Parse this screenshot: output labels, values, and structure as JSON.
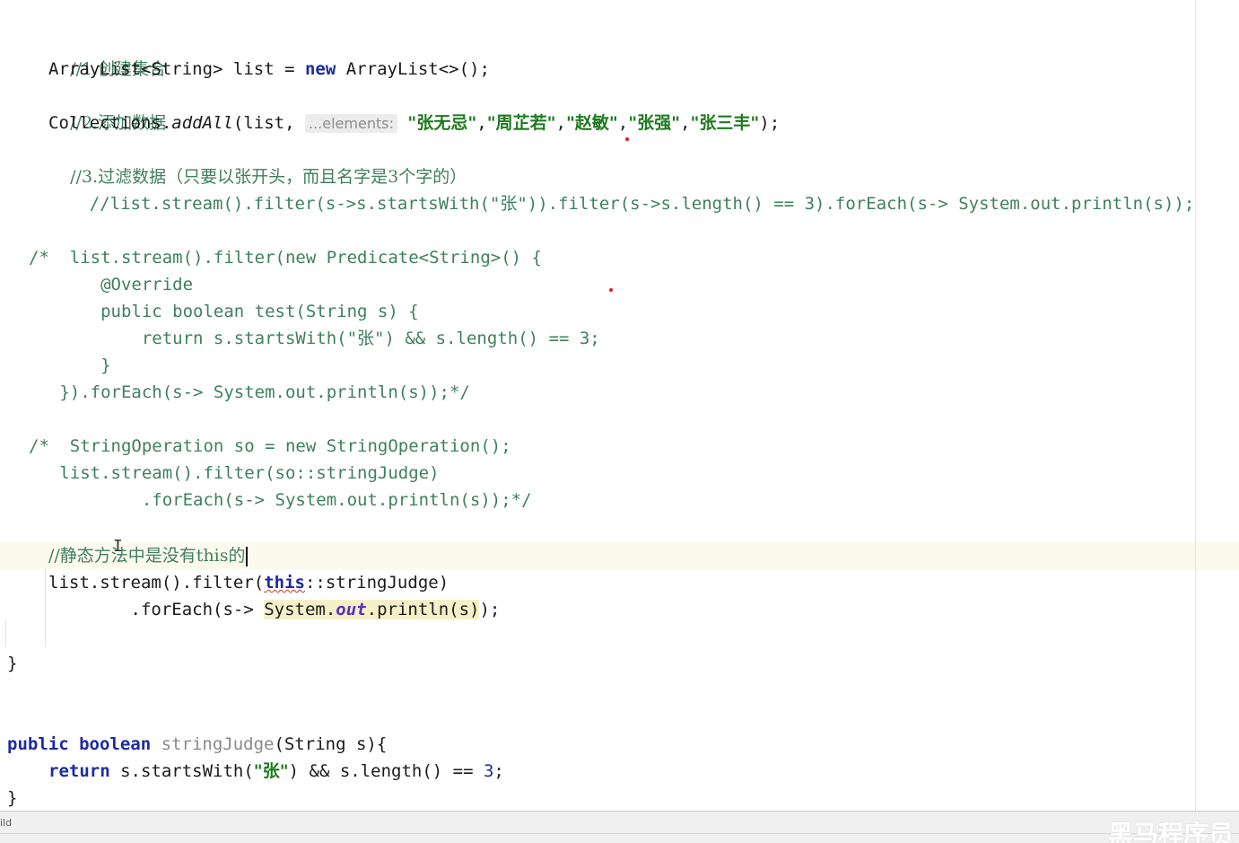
{
  "editor": {
    "comment_create": "//1.创建集合",
    "comment_add": "//2.添加数据",
    "comment_filter": "//3.过滤数据（只要以张开头，而且名字是3个字的）",
    "comment_stream": "//list.stream().filter(s->s.startsWith(\"张\")).filter(s->s.length() == 3).forEach(s-> System.out.println(s));",
    "comment_static": "//静态方法中是没有this的",
    "param_hint": "...elements:",
    "names": [
      "\"张无忌\"",
      "\"周芷若\"",
      "\"赵敏\"",
      "\"张强\"",
      "\"张三丰\""
    ],
    "zhang": "张",
    "length_three": "3",
    "block1": [
      "/*  list.stream().filter(new Predicate<String>() {",
      "       @Override",
      "       public boolean test(String s) {",
      "           return s.startsWith(\"张\") && s.length() == 3;",
      "       }",
      "   }).forEach(s-> System.out.println(s));*/"
    ],
    "block2": [
      "/*  StringOperation so = new StringOperation();",
      "   list.stream().filter(so::stringJudge)",
      "           .forEach(s-> System.out.println(s));*/"
    ]
  },
  "statusbar": {
    "left_text": "ild",
    "watermark": "黑马程序员"
  },
  "colors": {
    "keyword": "#1c2ba3",
    "string": "#1e7a1e",
    "comment": "#3f7f5f",
    "field": "#5a34b8",
    "current_line": "#fcfaed",
    "highlight": "#f6f0c8"
  }
}
